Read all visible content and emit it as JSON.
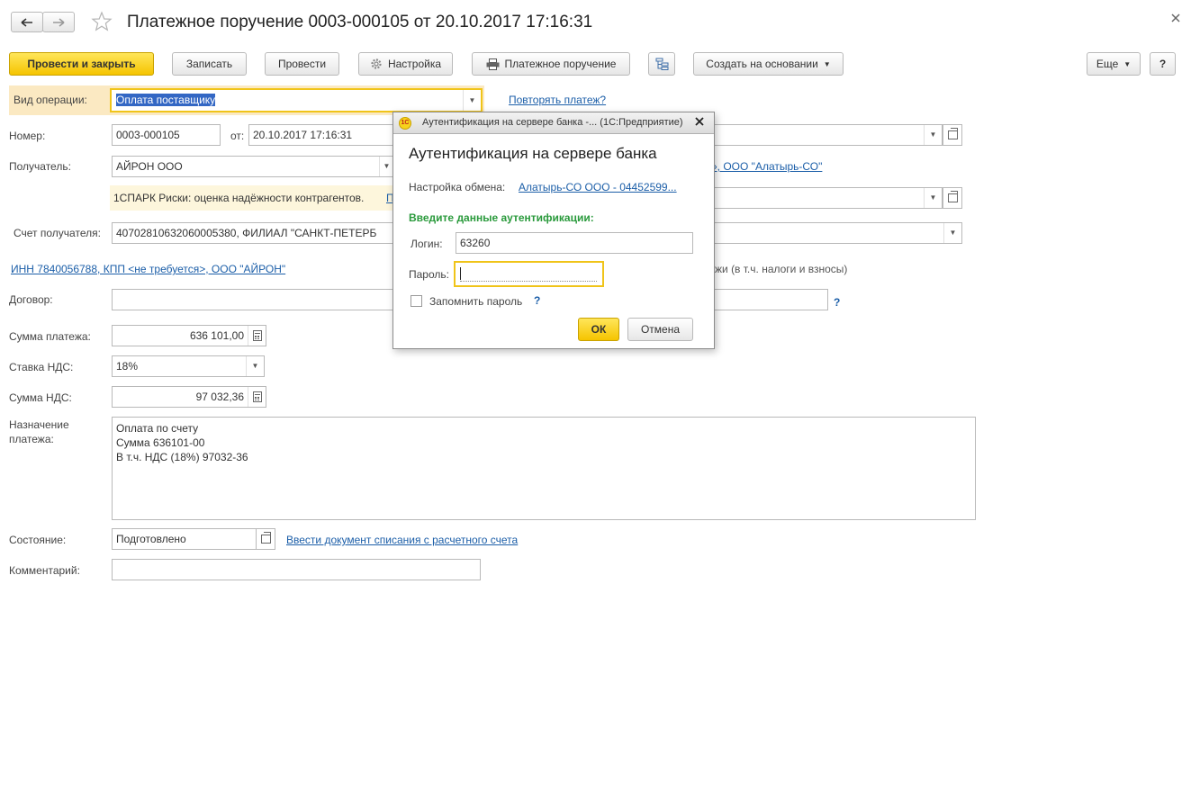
{
  "window": {
    "title": "Платежное поручение 0003-000105 от 20.10.2017 17:16:31",
    "back_icon": "arrow-left-icon",
    "forward_icon": "arrow-right-icon",
    "favorite_icon": "star-icon",
    "close_icon": "close-icon"
  },
  "toolbar": {
    "post_close": "Провести и закрыть",
    "save": "Записать",
    "post": "Провести",
    "settings": "Настройка",
    "payment_order": "Платежное поручение",
    "create_based_on": "Создать на основании",
    "more": "Еще",
    "help": "?"
  },
  "form": {
    "operation_label": "Вид операции:",
    "operation_value": "Оплата поставщику",
    "repeat_payment_link": "Повторять платеж?",
    "number_label": "Номер:",
    "number_value": "0003-000105",
    "date_from_label": "от:",
    "date_value": "20.10.2017 17:16:31",
    "recipient_label": "Получатель:",
    "recipient_value": "АЙРОН ООО",
    "org_link": "», ООО \"Алатырь-СО\"",
    "spark_text": "1СПАРК Риски: оценка надёжности контрагентов.",
    "spark_link_fragment": "П",
    "account_label": "Счет получателя:",
    "account_value": "40702810632060005380, ФИЛИАЛ \"САНКТ-ПЕТЕРБ",
    "inn_link": "ИНН 7840056788, КПП <не требуется>, ООО \"АЙРОН\"",
    "taxes_text": "жи (в т.ч. налоги и взносы)",
    "contract_label": "Договор:",
    "contract_help": "?",
    "sum_label": "Сумма платежа:",
    "sum_value": "636 101,00",
    "vat_rate_label": "Ставка НДС:",
    "vat_rate_value": "18%",
    "vat_sum_label": "Сумма НДС:",
    "vat_sum_value": "97 032,36",
    "purpose_label_1": "Назначение",
    "purpose_label_2": "платежа:",
    "purpose_lines": [
      "Оплата по счету",
      "Сумма 636101-00",
      "В т.ч. НДС  (18%) 97032-36"
    ],
    "status_label": "Состояние:",
    "status_value": "Подготовлено",
    "writeoff_link": "Ввести документ списания с расчетного счета",
    "comment_label": "Комментарий:",
    "comment_value": ""
  },
  "dialog": {
    "title": "Аутентификация на сервере банка -...  (1С:Предприятие)",
    "heading": "Аутентификация на сервере банка",
    "exchange_label": "Настройка обмена:",
    "exchange_link": "Алатырь-СО ООО - 04452599...",
    "prompt": "Введите данные аутентификации:",
    "login_label": "Логин:",
    "login_value": "63260",
    "password_label": "Пароль:",
    "password_value": "",
    "remember_label": "Запомнить пароль",
    "remember_help": "?",
    "remember_checked": false,
    "ok": "ОК",
    "cancel": "Отмена",
    "app_icon": "1c-logo-icon"
  },
  "colors": {
    "primary_button": "#f5c400",
    "link": "#1b5ea8",
    "prompt_green": "#2a9a3c",
    "highlight_row": "#fbe9c2",
    "spark_bg": "#fdf6dc",
    "focus_border": "#f0c419"
  }
}
